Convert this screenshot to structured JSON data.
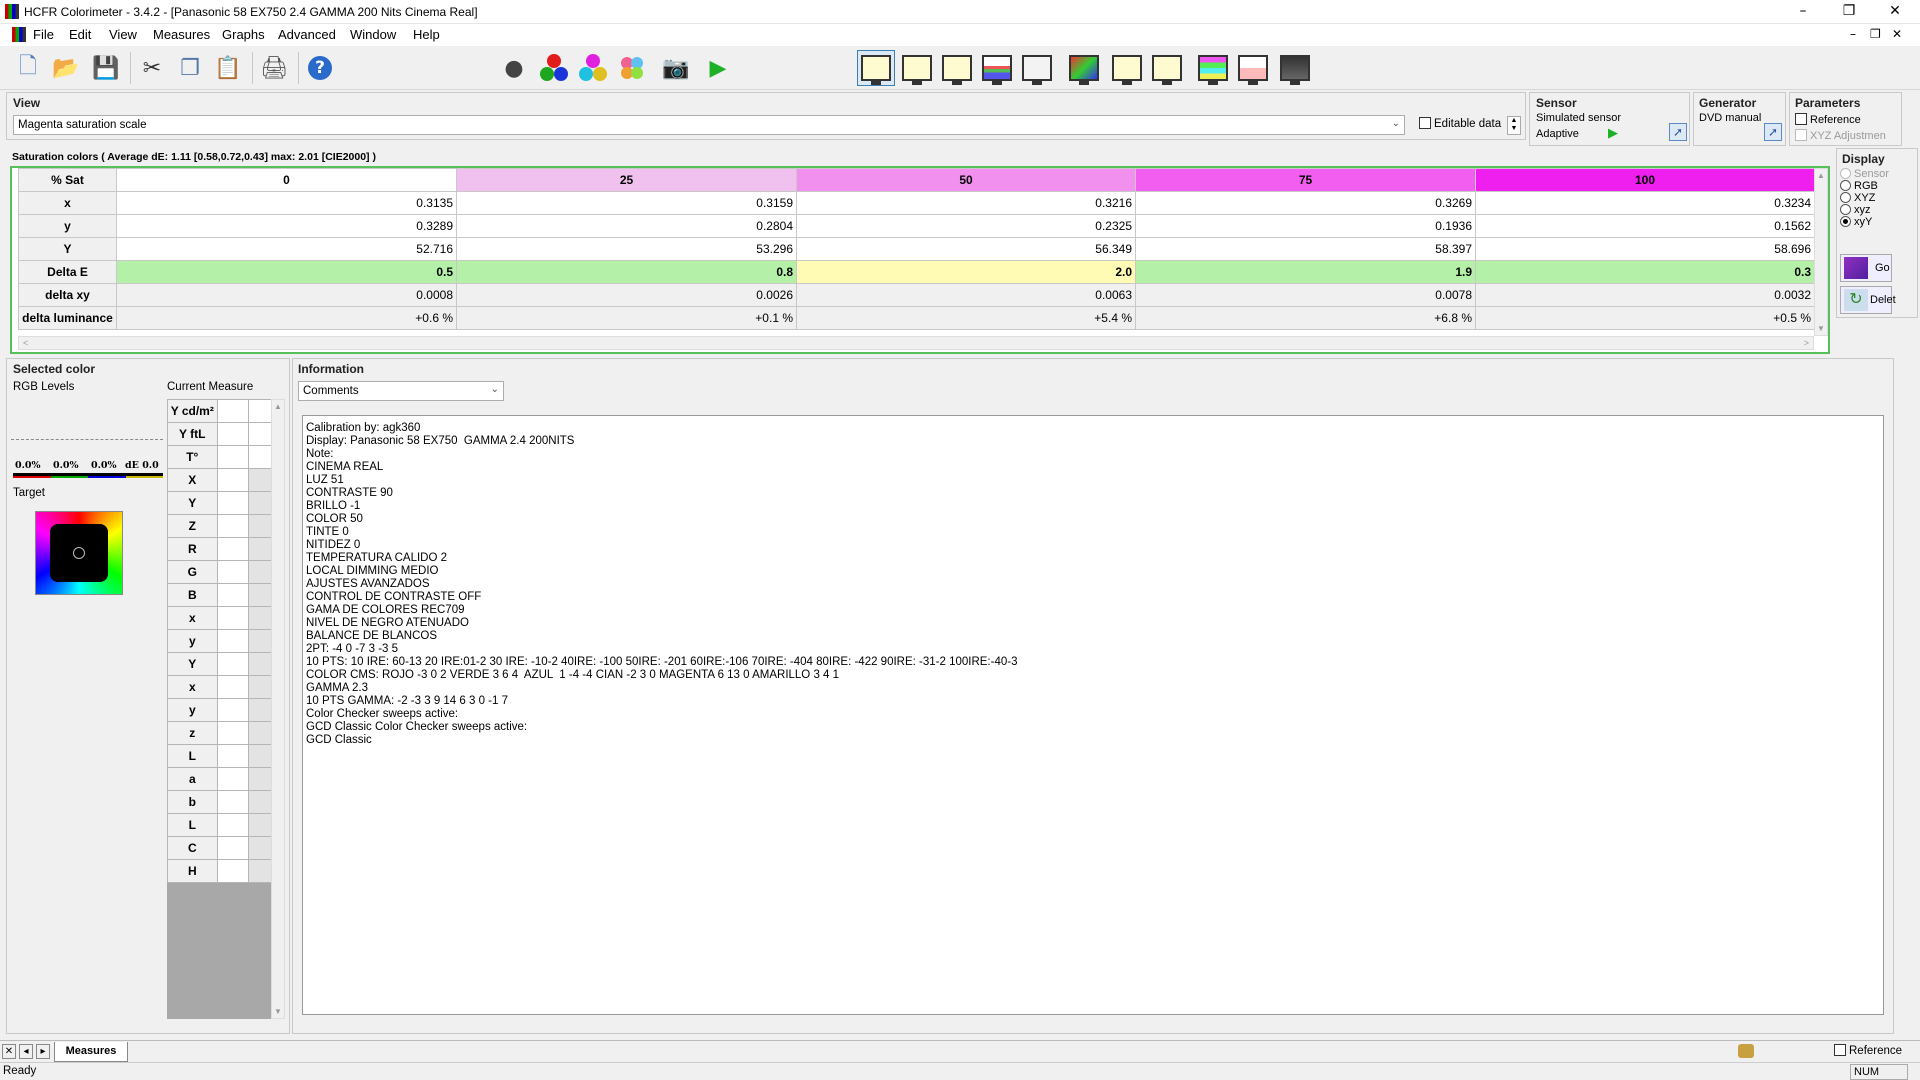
{
  "window": {
    "title": "HCFR Colorimeter - 3.4.2 - [Panasonic 58 EX750 2.4 GAMMA 200 Nits Cinema Real]"
  },
  "menu": [
    "File",
    "Edit",
    "View",
    "Measures",
    "Graphs",
    "Advanced",
    "Window",
    "Help"
  ],
  "view": {
    "header": "View",
    "dropdown": "Magenta saturation scale",
    "editable_label": "Editable data"
  },
  "sensor": {
    "header": "Sensor",
    "line1": "Simulated sensor",
    "line2": "Adaptive"
  },
  "generator": {
    "header": "Generator",
    "line1": "DVD manual"
  },
  "parameters": {
    "header": "Parameters",
    "reference": "Reference",
    "xyz_adj": "XYZ Adjustmen"
  },
  "display": {
    "header": "Display",
    "options": [
      "Sensor",
      "RGB",
      "XYZ",
      "xyz",
      "xyY"
    ],
    "selected": "xyY",
    "go_label": "Go",
    "delete_label": "Delet"
  },
  "saturation": {
    "caption": "Saturation colors ( Average dE: 1.11 [0.58,0.72,0.43] max: 2.01 [CIE2000] )",
    "corner": "% Sat",
    "columns": [
      "0",
      "25",
      "50",
      "75",
      "100"
    ],
    "header_colors": [
      "#ffffff",
      "#f0c0ef",
      "#f290ef",
      "#f25ef0",
      "#ef20ef"
    ],
    "rows": [
      {
        "label": "x",
        "values": [
          "0.3135",
          "0.3159",
          "0.3216",
          "0.3269",
          "0.3234"
        ]
      },
      {
        "label": "y",
        "values": [
          "0.3289",
          "0.2804",
          "0.2325",
          "0.1936",
          "0.1562"
        ]
      },
      {
        "label": "Y",
        "values": [
          "52.716",
          "53.296",
          "56.349",
          "58.397",
          "58.696"
        ]
      },
      {
        "label": "Delta E",
        "values": [
          "0.5",
          "0.8",
          "2.0",
          "1.9",
          "0.3"
        ]
      },
      {
        "label": "delta xy",
        "values": [
          "0.0008",
          "0.0026",
          "0.0063",
          "0.0078",
          "0.0032"
        ]
      },
      {
        "label": "delta luminance",
        "values": [
          "+0.6 %",
          "+0.1 %",
          "+5.4 %",
          "+6.8 %",
          "+0.5 %"
        ]
      }
    ]
  },
  "selected": {
    "header": "Selected color",
    "rgb_label": "RGB Levels",
    "current_label": "Current Measure",
    "levels": [
      "0.0%",
      "0.0%",
      "0.0%",
      "dE 0.0"
    ],
    "target_label": "Target",
    "measure_rows": [
      "Y cd/m²",
      "Y ftL",
      "T°",
      "X",
      "Y",
      "Z",
      "R",
      "G",
      "B",
      "x",
      "y",
      "Y",
      "x",
      "y",
      "z",
      "L",
      "a",
      "b",
      "L",
      "C",
      "H"
    ]
  },
  "information": {
    "header": "Information",
    "dropdown": "Comments",
    "lines": [
      "Calibration by: agk360",
      "Display: Panasonic 58 EX750  GAMMA 2.4 200NITS",
      "Note:",
      "CINEMA REAL",
      "LUZ 51",
      "CONTRASTE 90",
      "BRILLO -1",
      "COLOR 50",
      "TINTE 0",
      "NITIDEZ 0",
      "TEMPERATURA CALIDO 2",
      "LOCAL DIMMING MEDIO",
      "AJUSTES AVANZADOS",
      "CONTROL DE CONTRASTE OFF",
      "GAMA DE COLORES REC709",
      "NIVEL DE NEGRO ATENUADO",
      "BALANCE DE BLANCOS",
      "2PT: -4 0 -7 3 -3 5",
      "10 PTS: 10 IRE: 60-13 20 IRE:01-2 30 IRE: -10-2 40IRE: -100 50IRE: -201 60IRE:-106 70IRE: -404 80IRE: -422 90IRE: -31-2 100IRE:-40-3",
      "COLOR CMS: ROJO -3 0 2 VERDE 3 6 4  AZUL  1 -4 -4 CIAN -2 3 0 MAGENTA 6 13 0 AMARILLO 3 4 1",
      "GAMMA 2.3",
      "10 PTS GAMMA: -2 -3 3 9 14 6 3 0 -1 7",
      "Color Checker sweeps active:",
      "GCD Classic Color Checker sweeps active:",
      "GCD Classic"
    ]
  },
  "tabs": {
    "active": "Measures",
    "reference": "Reference"
  },
  "status": {
    "text": "Ready",
    "num": "NUM"
  }
}
